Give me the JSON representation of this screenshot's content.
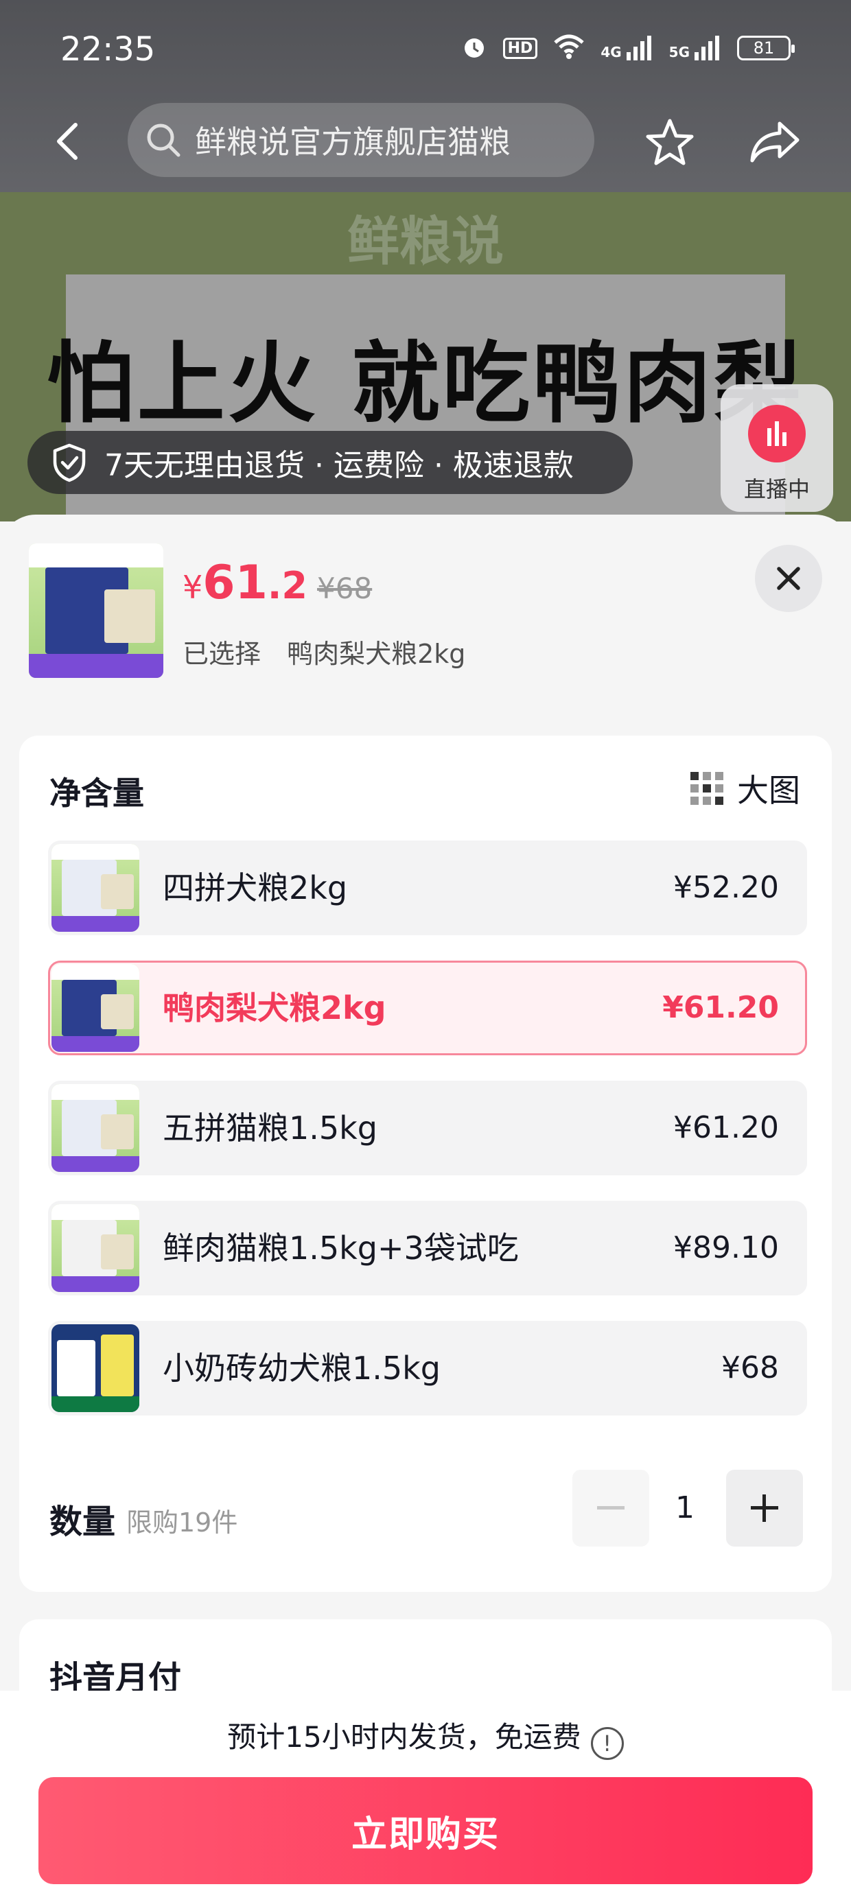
{
  "status_bar": {
    "time": "22:35",
    "hd_label": "HD",
    "signal_4g": "4G",
    "signal_5g": "5G",
    "battery": "81"
  },
  "nav": {
    "search_text": "鲜粮说官方旗舰店猫粮"
  },
  "background": {
    "brand": "鲜粮说",
    "slogan": "怕上火 就吃鸭肉梨"
  },
  "guarantee_text": "7天无理由退货 · 运费险 · 极速退款",
  "live_badge": "直播中",
  "sheet": {
    "price_symbol": "¥",
    "price_int": "61",
    "price_dec": ".2",
    "original_price": "¥68",
    "selected_label": "已选择",
    "selected_value": "鸭肉梨犬粮2kg",
    "spec_title": "净含量",
    "big_image_label": "大图",
    "options": [
      {
        "name": "四拼犬粮2kg",
        "price": "¥52.20",
        "selected": false
      },
      {
        "name": "鸭肉梨犬粮2kg",
        "price": "¥61.20",
        "selected": true
      },
      {
        "name": "五拼猫粮1.5kg",
        "price": "¥61.20",
        "selected": false
      },
      {
        "name": "鲜肉猫粮1.5kg+3袋试吃",
        "price": "¥89.10",
        "selected": false
      },
      {
        "name": "小奶砖幼犬粮1.5kg",
        "price": "¥68",
        "selected": false
      }
    ],
    "quantity_title": "数量",
    "quantity_limit": "限购19件",
    "quantity_value": "1",
    "monthly_pay_title": "抖音月付"
  },
  "footer": {
    "shipping_text": "预计15小时内发货，免运费",
    "buy_label": "立即购买"
  },
  "colors": {
    "accent": "#f23b5a",
    "buy_button": "#fe2c55",
    "selected_bg": "#fff1f3"
  }
}
